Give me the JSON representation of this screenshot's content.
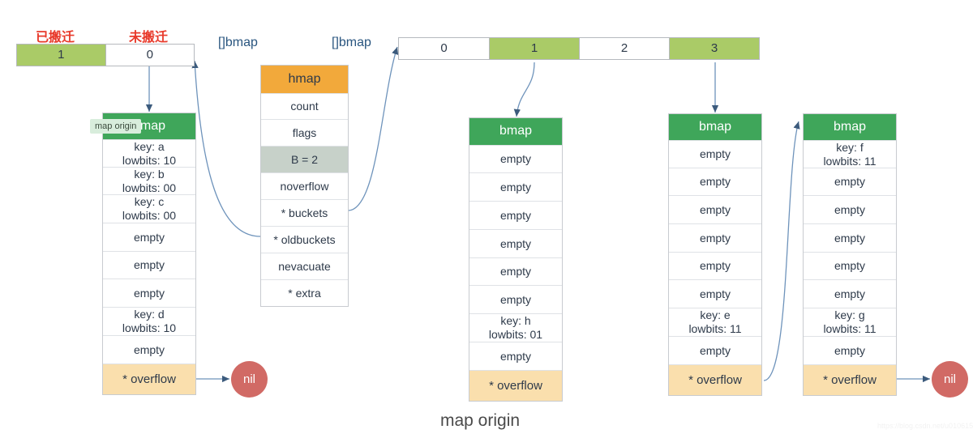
{
  "caption": "map origin",
  "watermark": "https://blog.csdn.net/u010615159",
  "colors": {
    "green_fill": "#aacb67",
    "bmap_header": "#3fa65a",
    "hmap_header": "#f2a93b",
    "overflow": "#fadfad",
    "shade": "#c7d1c9",
    "nil": "#d16a65",
    "arrow": "#5b85b0",
    "red_label": "#e8392a",
    "blue_label": "#29557f"
  },
  "evacuation_strip": {
    "labels": [
      {
        "text": "已搬迁"
      },
      {
        "text": "未搬迁"
      }
    ],
    "cells": [
      {
        "value": "1",
        "filled": true
      },
      {
        "value": "0",
        "filled": false
      }
    ]
  },
  "type_labels": [
    {
      "text": "[]bmap"
    },
    {
      "text": "[]bmap"
    }
  ],
  "buckets_strip": {
    "cells": [
      {
        "value": "0",
        "filled": false
      },
      {
        "value": "1",
        "filled": true
      },
      {
        "value": "2",
        "filled": false
      },
      {
        "value": "3",
        "filled": true
      }
    ]
  },
  "hmap": {
    "header": "hmap",
    "fields": [
      {
        "label": "count",
        "shade": false
      },
      {
        "label": "flags",
        "shade": false
      },
      {
        "label": "B = 2",
        "shade": true
      },
      {
        "label": "noverflow",
        "shade": false
      },
      {
        "label": "* buckets",
        "shade": false
      },
      {
        "label": "* oldbuckets",
        "shade": false
      },
      {
        "label": "nevacuate",
        "shade": false
      },
      {
        "label": "* extra",
        "shade": false
      }
    ]
  },
  "tooltip": {
    "text": "map origin"
  },
  "buckets": [
    {
      "id": "oldbucket-0",
      "header": "bmap",
      "slots": [
        {
          "key": "key: a",
          "lowbits": "lowbits: 10"
        },
        {
          "key": "key: b",
          "lowbits": "lowbits: 00"
        },
        {
          "key": "key: c",
          "lowbits": "lowbits: 00"
        },
        {
          "key": "empty",
          "lowbits": ""
        },
        {
          "key": "empty",
          "lowbits": ""
        },
        {
          "key": "empty",
          "lowbits": ""
        },
        {
          "key": "key: d",
          "lowbits": "lowbits: 10"
        },
        {
          "key": "empty",
          "lowbits": ""
        }
      ],
      "overflow": "* overflow"
    },
    {
      "id": "newbucket-1",
      "header": "bmap",
      "slots": [
        {
          "key": "empty",
          "lowbits": ""
        },
        {
          "key": "empty",
          "lowbits": ""
        },
        {
          "key": "empty",
          "lowbits": ""
        },
        {
          "key": "empty",
          "lowbits": ""
        },
        {
          "key": "empty",
          "lowbits": ""
        },
        {
          "key": "empty",
          "lowbits": ""
        },
        {
          "key": "key: h",
          "lowbits": "lowbits: 01"
        },
        {
          "key": "empty",
          "lowbits": ""
        }
      ],
      "overflow": "* overflow"
    },
    {
      "id": "newbucket-3",
      "header": "bmap",
      "slots": [
        {
          "key": "empty",
          "lowbits": ""
        },
        {
          "key": "empty",
          "lowbits": ""
        },
        {
          "key": "empty",
          "lowbits": ""
        },
        {
          "key": "empty",
          "lowbits": ""
        },
        {
          "key": "empty",
          "lowbits": ""
        },
        {
          "key": "empty",
          "lowbits": ""
        },
        {
          "key": "key: e",
          "lowbits": "lowbits: 11"
        },
        {
          "key": "empty",
          "lowbits": ""
        }
      ],
      "overflow": "* overflow"
    },
    {
      "id": "overflowbucket-3",
      "header": "bmap",
      "slots": [
        {
          "key": "key: f",
          "lowbits": "lowbits: 11"
        },
        {
          "key": "empty",
          "lowbits": ""
        },
        {
          "key": "empty",
          "lowbits": ""
        },
        {
          "key": "empty",
          "lowbits": ""
        },
        {
          "key": "empty",
          "lowbits": ""
        },
        {
          "key": "empty",
          "lowbits": ""
        },
        {
          "key": "key: g",
          "lowbits": "lowbits: 11"
        },
        {
          "key": "empty",
          "lowbits": ""
        }
      ],
      "overflow": "* overflow"
    }
  ],
  "nil_nodes": [
    {
      "label": "nil"
    },
    {
      "label": "nil"
    }
  ]
}
